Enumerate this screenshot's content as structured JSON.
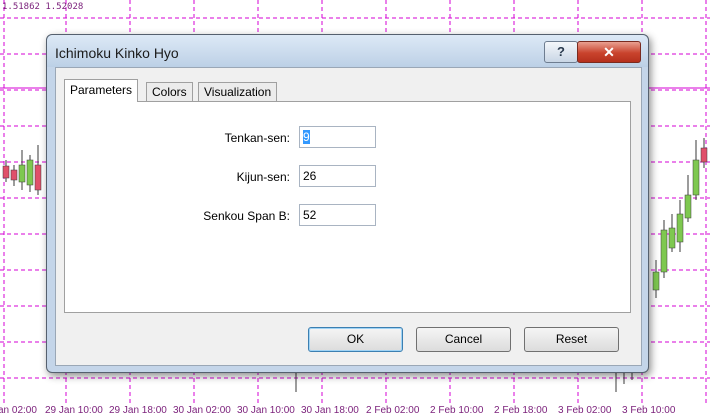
{
  "chart": {
    "ohlc_text": "1.51862 1.52028",
    "time_labels": [
      "an 02:00",
      "29 Jan 10:00",
      "29 Jan 18:00",
      "30 Jan 02:00",
      "30 Jan 10:00",
      "30 Jan 18:00",
      "2 Feb 02:00",
      "2 Feb 10:00",
      "2 Feb 18:00",
      "3 Feb 02:00",
      "3 Feb 10:00"
    ],
    "colors": {
      "grid": "#d400d4",
      "bull": "#7ec850",
      "bear": "#e0506a",
      "wick": "#3a3a3a"
    }
  },
  "dialog": {
    "title": "Ichimoku Kinko Hyo",
    "help_glyph": "?",
    "close_glyph": "✕",
    "tabs": [
      {
        "label": "Parameters",
        "active": true
      },
      {
        "label": "Colors",
        "active": false
      },
      {
        "label": "Visualization",
        "active": false
      }
    ],
    "params": [
      {
        "label": "Tenkan-sen:",
        "value": "9"
      },
      {
        "label": "Kijun-sen:",
        "value": "26"
      },
      {
        "label": "Senkou Span B:",
        "value": "52"
      }
    ],
    "buttons": {
      "ok": "OK",
      "cancel": "Cancel",
      "reset": "Reset"
    }
  }
}
